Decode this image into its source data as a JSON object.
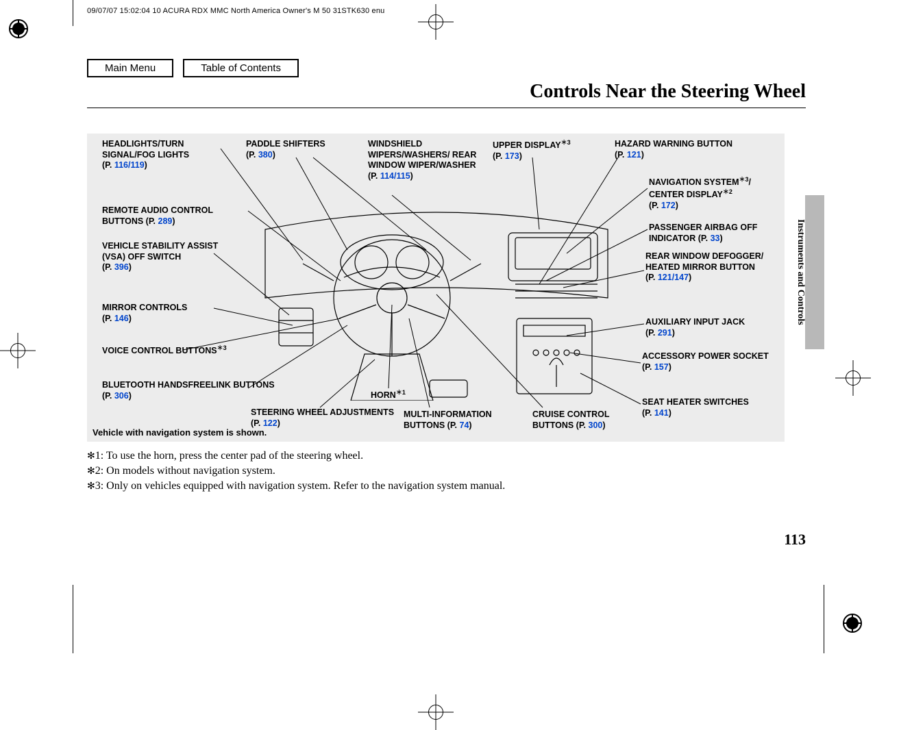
{
  "header_meta": "09/07/07 15:02:04   10 ACURA RDX MMC North America Owner's M 50 31STK630 enu",
  "nav": {
    "main_menu": "Main Menu",
    "toc": "Table of Contents"
  },
  "title": "Controls Near the Steering Wheel",
  "side_tab": "Instruments and Controls",
  "diagram_caption": "Vehicle with navigation system is shown.",
  "callouts": {
    "headlights": {
      "label": "HEADLIGHTS/TURN SIGNAL/FOG LIGHTS",
      "page_prefix": "(P. ",
      "pages": "116/119",
      "page_suffix": ")"
    },
    "paddle": {
      "label": "PADDLE SHIFTERS",
      "page_prefix": "(P. ",
      "pages": "380",
      "page_suffix": ")"
    },
    "wipers": {
      "label": "WINDSHIELD WIPERS/WASHERS/ REAR WINDOW WIPER/WASHER",
      "page_prefix": "(P. ",
      "pages": "114/115",
      "page_suffix": ")"
    },
    "upper_disp": {
      "label": "UPPER DISPLAY",
      "sup": "＊3",
      "page_prefix": "(P. ",
      "pages": "173",
      "page_suffix": ")"
    },
    "hazard": {
      "label": "HAZARD WARNING BUTTON",
      "page_prefix": "(P. ",
      "pages": "121",
      "page_suffix": ")"
    },
    "navsys": {
      "label_a": "NAVIGATION SYSTEM",
      "sup_a": "＊3",
      "label_b": "/ CENTER DISPLAY",
      "sup_b": "＊2",
      "page_prefix": "(P. ",
      "pages": "172",
      "page_suffix": ")"
    },
    "pass_airbag": {
      "label": "PASSENGER AIRBAG OFF INDICATOR (P. ",
      "pages": "33",
      "page_suffix": ")"
    },
    "defog": {
      "label": "REAR WINDOW DEFOGGER/ HEATED MIRROR BUTTON",
      "page_prefix": "(P. ",
      "pages": "121/147",
      "page_suffix": ")"
    },
    "aux": {
      "label": "AUXILIARY INPUT JACK",
      "page_prefix": "(P. ",
      "pages": "291",
      "page_suffix": ")"
    },
    "acc_power": {
      "label": "ACCESSORY POWER SOCKET",
      "page_prefix": "(P. ",
      "pages": "157",
      "page_suffix": ")"
    },
    "seat_heat": {
      "label": "SEAT HEATER SWITCHES",
      "page_prefix": "(P. ",
      "pages": "141",
      "page_suffix": ")"
    },
    "remote_aud": {
      "label": "REMOTE AUDIO CONTROL BUTTONS (P. ",
      "pages": "289",
      "page_suffix": ")"
    },
    "vsa": {
      "label": "VEHICLE STABILITY ASSIST (VSA) OFF SWITCH",
      "page_prefix": "(P. ",
      "pages": "396",
      "page_suffix": ")"
    },
    "mirror": {
      "label": "MIRROR CONTROLS",
      "page_prefix": "(P. ",
      "pages": "146",
      "page_suffix": ")"
    },
    "voice": {
      "label": "VOICE CONTROL BUTTONS",
      "sup": "＊3"
    },
    "bt": {
      "label": "BLUETOOTH HANDSFREELINK BUTTONS (P. ",
      "pages": "306",
      "page_suffix": ")"
    },
    "steer_adj": {
      "label": "STEERING WHEEL ADJUSTMENTS (P. ",
      "pages": "122",
      "page_suffix": ")"
    },
    "horn": {
      "label": "HORN",
      "sup": "＊1"
    },
    "mid": {
      "label": "MULTI-INFORMATION BUTTONS (P. ",
      "pages": "74",
      "page_suffix": ")"
    },
    "cruise": {
      "label": "CRUISE CONTROL BUTTONS (P. ",
      "pages": "300",
      "page_suffix": ")"
    }
  },
  "footnotes": {
    "f1": "1: To use the horn, press the center pad of the steering wheel.",
    "f2": "2: On models without navigation system.",
    "f3": "3: Only on vehicles equipped with navigation system. Refer to the navigation system manual."
  },
  "page_number": "113"
}
